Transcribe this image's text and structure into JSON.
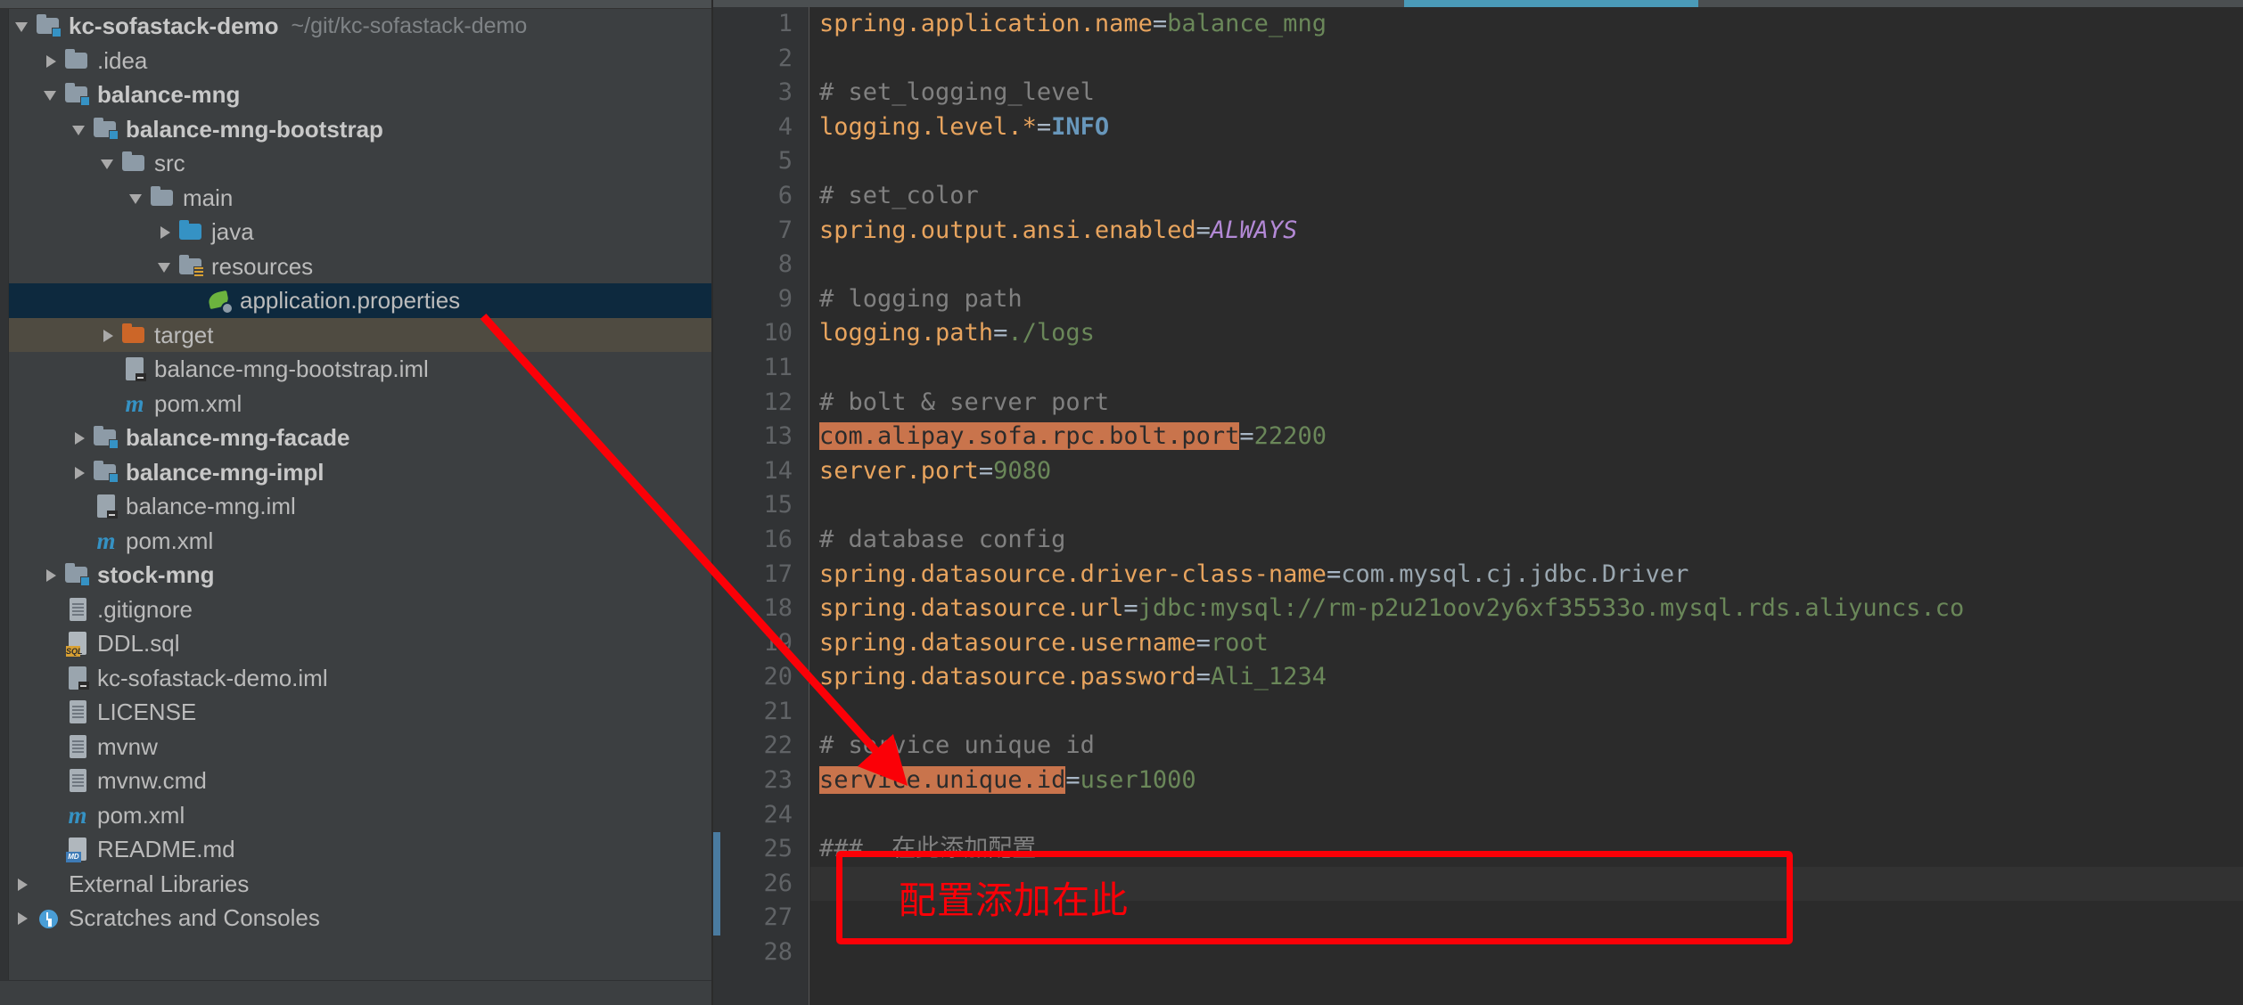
{
  "window": {
    "project_name": "kc-sofastack-demo",
    "project_path": "~/git/kc-sofastack-demo"
  },
  "sidebar": {
    "name": "project-tree",
    "items": [
      {
        "label": "kc-sofastack-demo",
        "path": "~/git/kc-sofastack-demo",
        "depth": 0,
        "arrow": "down",
        "icon": "folder-module-icon",
        "bold": true,
        "state": "normal"
      },
      {
        "label": ".idea",
        "path": "",
        "depth": 1,
        "arrow": "right",
        "icon": "folder-icon",
        "bold": false,
        "state": "normal"
      },
      {
        "label": "balance-mng",
        "path": "",
        "depth": 1,
        "arrow": "down",
        "icon": "folder-module-icon",
        "bold": true,
        "state": "normal"
      },
      {
        "label": "balance-mng-bootstrap",
        "path": "",
        "depth": 2,
        "arrow": "down",
        "icon": "folder-module-icon",
        "bold": true,
        "state": "normal"
      },
      {
        "label": "src",
        "path": "",
        "depth": 3,
        "arrow": "down",
        "icon": "folder-icon",
        "bold": false,
        "state": "normal"
      },
      {
        "label": "main",
        "path": "",
        "depth": 4,
        "arrow": "down",
        "icon": "folder-icon",
        "bold": false,
        "state": "normal"
      },
      {
        "label": "java",
        "path": "",
        "depth": 5,
        "arrow": "right",
        "icon": "folder-sources-icon",
        "bold": false,
        "state": "normal"
      },
      {
        "label": "resources",
        "path": "",
        "depth": 5,
        "arrow": "down",
        "icon": "folder-resources-icon",
        "bold": false,
        "state": "normal"
      },
      {
        "label": "application.properties",
        "path": "",
        "depth": 6,
        "arrow": "none",
        "icon": "spring-properties-icon",
        "bold": false,
        "state": "selected"
      },
      {
        "label": "target",
        "path": "",
        "depth": 3,
        "arrow": "right",
        "icon": "folder-excluded-icon",
        "bold": false,
        "state": "target"
      },
      {
        "label": "balance-mng-bootstrap.iml",
        "path": "",
        "depth": 3,
        "arrow": "none",
        "icon": "iml-file-icon",
        "bold": false,
        "state": "normal"
      },
      {
        "label": "pom.xml",
        "path": "",
        "depth": 3,
        "arrow": "none",
        "icon": "maven-icon",
        "bold": false,
        "state": "normal"
      },
      {
        "label": "balance-mng-facade",
        "path": "",
        "depth": 2,
        "arrow": "right",
        "icon": "folder-module-icon",
        "bold": true,
        "state": "normal"
      },
      {
        "label": "balance-mng-impl",
        "path": "",
        "depth": 2,
        "arrow": "right",
        "icon": "folder-module-icon",
        "bold": true,
        "state": "normal"
      },
      {
        "label": "balance-mng.iml",
        "path": "",
        "depth": 2,
        "arrow": "none",
        "icon": "iml-file-icon",
        "bold": false,
        "state": "normal"
      },
      {
        "label": "pom.xml",
        "path": "",
        "depth": 2,
        "arrow": "none",
        "icon": "maven-icon",
        "bold": false,
        "state": "normal"
      },
      {
        "label": "stock-mng",
        "path": "",
        "depth": 1,
        "arrow": "right",
        "icon": "folder-module-icon",
        "bold": true,
        "state": "normal"
      },
      {
        "label": ".gitignore",
        "path": "",
        "depth": 1,
        "arrow": "none",
        "icon": "text-file-icon",
        "bold": false,
        "state": "normal"
      },
      {
        "label": "DDL.sql",
        "path": "",
        "depth": 1,
        "arrow": "none",
        "icon": "sql-file-icon",
        "bold": false,
        "state": "normal"
      },
      {
        "label": "kc-sofastack-demo.iml",
        "path": "",
        "depth": 1,
        "arrow": "none",
        "icon": "iml-file-icon",
        "bold": false,
        "state": "normal"
      },
      {
        "label": "LICENSE",
        "path": "",
        "depth": 1,
        "arrow": "none",
        "icon": "text-file-icon",
        "bold": false,
        "state": "normal"
      },
      {
        "label": "mvnw",
        "path": "",
        "depth": 1,
        "arrow": "none",
        "icon": "text-file-icon",
        "bold": false,
        "state": "normal"
      },
      {
        "label": "mvnw.cmd",
        "path": "",
        "depth": 1,
        "arrow": "none",
        "icon": "text-file-icon",
        "bold": false,
        "state": "normal"
      },
      {
        "label": "pom.xml",
        "path": "",
        "depth": 1,
        "arrow": "none",
        "icon": "maven-icon",
        "bold": false,
        "state": "normal"
      },
      {
        "label": "README.md",
        "path": "",
        "depth": 1,
        "arrow": "none",
        "icon": "markdown-file-icon",
        "bold": false,
        "state": "normal"
      },
      {
        "label": "External Libraries",
        "path": "",
        "depth": 0,
        "arrow": "right",
        "icon": "external-libraries-icon",
        "bold": false,
        "state": "normal"
      },
      {
        "label": "Scratches and Consoles",
        "path": "",
        "depth": 0,
        "arrow": "right",
        "icon": "scratches-icon",
        "bold": false,
        "state": "normal"
      }
    ]
  },
  "editor": {
    "name": "application.properties",
    "line_numbers": [
      1,
      2,
      3,
      4,
      5,
      6,
      7,
      8,
      9,
      10,
      11,
      12,
      13,
      14,
      15,
      16,
      17,
      18,
      19,
      20,
      21,
      22,
      23,
      24,
      25,
      26,
      27,
      28
    ],
    "lines": [
      {
        "n": 1,
        "segments": [
          {
            "t": "spring.application.name",
            "c": "k"
          },
          {
            "t": "=",
            "c": "op"
          },
          {
            "t": "balance_mng",
            "c": "v"
          }
        ]
      },
      {
        "n": 2,
        "segments": []
      },
      {
        "n": 3,
        "segments": [
          {
            "t": "# set_logging_level",
            "c": "cm"
          }
        ]
      },
      {
        "n": 4,
        "segments": [
          {
            "t": "logging.level.*",
            "c": "k"
          },
          {
            "t": "=",
            "c": "op"
          },
          {
            "t": "INFO",
            "c": "bld"
          }
        ]
      },
      {
        "n": 5,
        "segments": []
      },
      {
        "n": 6,
        "segments": [
          {
            "t": "# set_color",
            "c": "cm"
          }
        ]
      },
      {
        "n": 7,
        "segments": [
          {
            "t": "spring.output.ansi.enabled",
            "c": "k"
          },
          {
            "t": "=",
            "c": "op"
          },
          {
            "t": "ALWAYS",
            "c": "kw"
          }
        ]
      },
      {
        "n": 8,
        "segments": []
      },
      {
        "n": 9,
        "segments": [
          {
            "t": "# logging path",
            "c": "cm"
          }
        ]
      },
      {
        "n": 10,
        "segments": [
          {
            "t": "logging.path",
            "c": "k"
          },
          {
            "t": "=",
            "c": "op"
          },
          {
            "t": "./logs",
            "c": "v"
          }
        ]
      },
      {
        "n": 11,
        "segments": []
      },
      {
        "n": 12,
        "segments": [
          {
            "t": "# bolt & server port",
            "c": "cm"
          }
        ]
      },
      {
        "n": 13,
        "segments": [
          {
            "t": "com.alipay.sofa.rpc.bolt.port",
            "c": "hl"
          },
          {
            "t": "=",
            "c": "op"
          },
          {
            "t": "22200",
            "c": "v"
          }
        ]
      },
      {
        "n": 14,
        "segments": [
          {
            "t": "server.port",
            "c": "k"
          },
          {
            "t": "=",
            "c": "op"
          },
          {
            "t": "9080",
            "c": "v"
          }
        ]
      },
      {
        "n": 15,
        "segments": []
      },
      {
        "n": 16,
        "segments": [
          {
            "t": "# database config",
            "c": "cm"
          }
        ]
      },
      {
        "n": 17,
        "segments": [
          {
            "t": "spring.datasource.driver-class-name",
            "c": "k"
          },
          {
            "t": "=",
            "c": "op"
          },
          {
            "t": "com.mysql.cj.jdbc.Driver",
            "c": "cls"
          }
        ]
      },
      {
        "n": 18,
        "segments": [
          {
            "t": "spring.datasource.url",
            "c": "k"
          },
          {
            "t": "=",
            "c": "op"
          },
          {
            "t": "jdbc:mysql://rm-p2u21oov2y6xf35533o.mysql.rds.aliyuncs.co",
            "c": "v"
          }
        ]
      },
      {
        "n": 19,
        "segments": [
          {
            "t": "spring.datasource.username",
            "c": "k"
          },
          {
            "t": "=",
            "c": "op"
          },
          {
            "t": "root",
            "c": "v"
          }
        ]
      },
      {
        "n": 20,
        "segments": [
          {
            "t": "spring.datasource.password",
            "c": "k"
          },
          {
            "t": "=",
            "c": "op"
          },
          {
            "t": "Ali_1234",
            "c": "v"
          }
        ]
      },
      {
        "n": 21,
        "segments": []
      },
      {
        "n": 22,
        "segments": [
          {
            "t": "# service unique id",
            "c": "cm"
          }
        ]
      },
      {
        "n": 23,
        "segments": [
          {
            "t": "service.unique.id",
            "c": "hl"
          },
          {
            "t": "=",
            "c": "op"
          },
          {
            "t": "user1000",
            "c": "v"
          }
        ]
      },
      {
        "n": 24,
        "segments": []
      },
      {
        "n": 25,
        "segments": [
          {
            "t": "###  在此添加配置",
            "c": "cm"
          }
        ]
      },
      {
        "n": 26,
        "segments": []
      },
      {
        "n": 27,
        "segments": []
      },
      {
        "n": 28,
        "segments": []
      }
    ]
  },
  "annotations": {
    "callout_label": "配置添加在此",
    "arrow_color": "#fb0007",
    "box_color": "#fb0007"
  },
  "colors": {
    "sidebar_bg": "#3c3f41",
    "editor_bg": "#2b2b2b",
    "gutter_bg": "#313335",
    "selection_bg": "#0d293e",
    "target_bg": "#4f4b41",
    "key": "#e8a45e",
    "value": "#6a8759",
    "comment": "#808080",
    "class": "#9aa7b0",
    "keyword": "#b389d6",
    "search_highlight": "#c9744c",
    "accent": "#4a9ab8"
  }
}
